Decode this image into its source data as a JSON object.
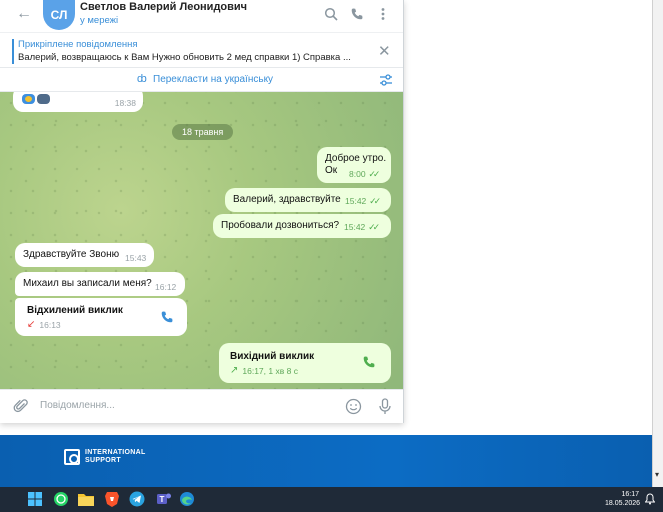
{
  "header": {
    "avatar_initials": "СЛ",
    "contact_name": "Светлов Валерий Леонидович",
    "status": "у мережі"
  },
  "pinned": {
    "title": "Прикріплене повідомлення",
    "text": "Валерий, возвращаюсь к Вам  Нужно обновить 2 мед справки 1) Справка ..."
  },
  "translate": {
    "label": "Перекласти на українську"
  },
  "chat": {
    "first_time": "18:38",
    "date_separator": "18 травня",
    "messages": [
      {
        "dir": "out",
        "text": "Доброе утро.",
        "text2": "Ок",
        "time": "8:00"
      },
      {
        "dir": "out",
        "text": "Валерий, здравствуйте",
        "time": "15:42"
      },
      {
        "dir": "out",
        "text": "Пробовали дозвониться?",
        "time": "15:42"
      },
      {
        "dir": "in",
        "text": "Здравствуйте Звоню",
        "time": "15:43"
      },
      {
        "dir": "in",
        "text": "Михаил вы записали меня?",
        "time": "16:12"
      }
    ],
    "call_in": {
      "title": "Відхилений виклик",
      "time": "16:13"
    },
    "call_out": {
      "title": "Вихідний виклик",
      "time": "16:17, 1 хв 8 с"
    }
  },
  "input": {
    "placeholder": "Повідомлення..."
  },
  "banner": {
    "logo_line1": "INTERNATIONAL",
    "logo_line2": "SUPPORT"
  },
  "taskbar": {
    "time": "16:17",
    "date": "18.05.2026"
  },
  "colors": {
    "accent": "#3a8fd8",
    "outgoing_bubble": "#eeffde",
    "incoming_bubble": "#ffffff",
    "read_ticks": "#4fae4e",
    "missed_call": "#e53935",
    "banner": "#0c6cc4",
    "taskbar": "#1f2a38"
  }
}
